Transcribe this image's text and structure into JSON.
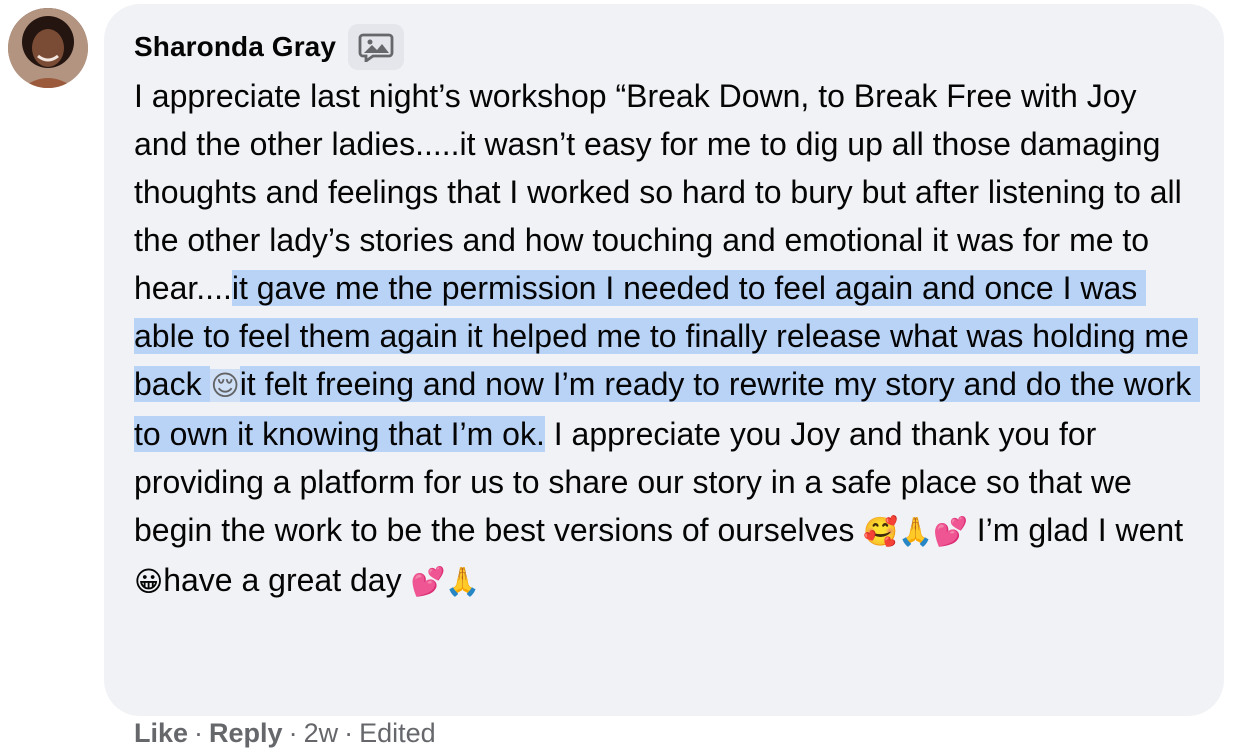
{
  "comment": {
    "author": "Sharonda Gray",
    "text_before": "I appreciate last night’s workshop “Break Down, to Break Free with Joy and the other ladies.....it wasn’t easy for me to dig up all those damaging thoughts and feelings that I worked so hard to bury but after listening to all the other lady’s stories and how touching and emotional it was for me to hear....",
    "text_highlight_1": "it gave me the permission I needed to feel again and once I was able to feel them again it helped me to finally release what was holding me back ",
    "emoji_relieved": "😌",
    "text_highlight_2": "it felt freeing and now I’m ready to rewrite my story and do the work to own it knowing that I’m ok.",
    "text_after_1": " I appreciate you Joy and thank you for providing a platform for us to share our story in a safe place so that we begin the work to be the best versions of ourselves ",
    "emoji_group_1": "🥰🙏💕",
    "text_after_2": " I’m glad I went ",
    "emoji_smile": "😀",
    "text_after_3": "have a great day ",
    "emoji_group_2": "💕🙏"
  },
  "actions": {
    "like": "Like",
    "reply": "Reply",
    "age": "2w",
    "edited": "Edited",
    "separator": "·"
  },
  "icons": {
    "avatar": "profile-photo",
    "badge": "photo-comment-icon"
  }
}
